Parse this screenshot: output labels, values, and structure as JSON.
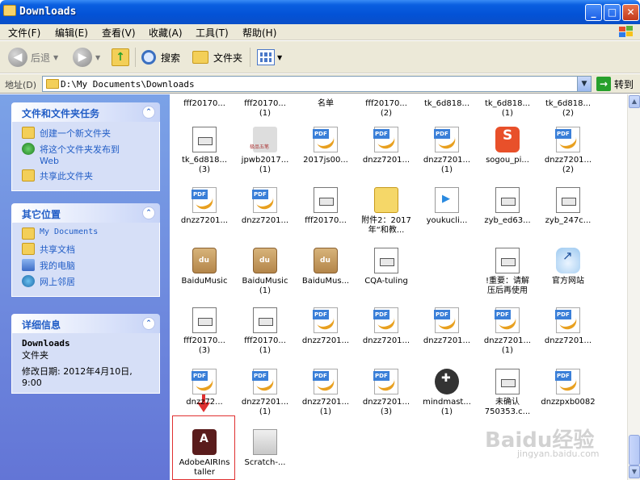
{
  "window": {
    "title": "Downloads",
    "min": "_",
    "max": "□",
    "close": "✕"
  },
  "menu": [
    "文件(F)",
    "编辑(E)",
    "查看(V)",
    "收藏(A)",
    "工具(T)",
    "帮助(H)"
  ],
  "toolbar": {
    "back": "后退",
    "search": "搜索",
    "folders": "文件夹"
  },
  "address": {
    "label": "地址(D)",
    "path": "D:\\My Documents\\Downloads",
    "go": "转到"
  },
  "sidebar": {
    "tasks": {
      "title": "文件和文件夹任务",
      "items": [
        "创建一个新文件夹",
        "将这个文件夹发布到\nWeb",
        "共享此文件夹"
      ]
    },
    "places": {
      "title": "其它位置",
      "items": [
        "My Documents",
        "共享文档",
        "我的电脑",
        "网上邻居"
      ]
    },
    "details": {
      "title": "详细信息",
      "name": "Downloads",
      "type": "文件夹",
      "modified": "修改日期: 2012年4月10日,\n9:00"
    }
  },
  "files": [
    {
      "label": "fff20170...",
      "icon": "doc-icon"
    },
    {
      "label": "fff20170...\n(1)",
      "icon": "doc-icon"
    },
    {
      "label": "名单",
      "icon": "doc-icon"
    },
    {
      "label": "fff20170...\n(2)",
      "icon": "doc-icon"
    },
    {
      "label": "tk_6d818...",
      "icon": "doc-icon"
    },
    {
      "label": "tk_6d818...\n(1)",
      "icon": "doc-icon"
    },
    {
      "label": "tk_6d818...\n(2)",
      "icon": "doc-icon"
    },
    {
      "label": "tk_6d818...\n(3)",
      "icon": "doc-icon"
    },
    {
      "label": "jpwb2017...\n(1)",
      "icon": "jpwb-icon"
    },
    {
      "label": "2017js00...",
      "icon": "pdf-icon"
    },
    {
      "label": "dnzz7201...",
      "icon": "pdf-icon"
    },
    {
      "label": "dnzz7201...\n(1)",
      "icon": "pdf-icon"
    },
    {
      "label": "sogou_pi...",
      "icon": "sogou-icon"
    },
    {
      "label": "dnzz7201...\n(2)",
      "icon": "pdf-icon"
    },
    {
      "label": "dnzz7201...",
      "icon": "pdf-icon"
    },
    {
      "label": "dnzz7201...",
      "icon": "pdf-icon"
    },
    {
      "label": "fff20170...",
      "icon": "doc-icon"
    },
    {
      "label": "附件2：2017\n年“和教...",
      "icon": "folder-icon"
    },
    {
      "label": "youkucli...",
      "icon": "video-icon"
    },
    {
      "label": "zyb_ed63...",
      "icon": "doc-icon"
    },
    {
      "label": "zyb_247c...",
      "icon": "doc-icon"
    },
    {
      "label": "BaiduMusic",
      "icon": "box-icon"
    },
    {
      "label": "BaiduMusic\n(1)",
      "icon": "box-icon"
    },
    {
      "label": "BaiduMus...",
      "icon": "box-icon"
    },
    {
      "label": "CQA-tuling",
      "icon": "doc-icon"
    },
    {
      "label": "",
      "icon": "none"
    },
    {
      "label": "!重要：请解\n压后再使用",
      "icon": "doc-icon"
    },
    {
      "label": "官方网站",
      "icon": "cloud-icon"
    },
    {
      "label": "fff20170...\n(3)",
      "icon": "doc-icon"
    },
    {
      "label": "fff20170...\n(1)",
      "icon": "doc-icon"
    },
    {
      "label": "dnzz7201...",
      "icon": "pdf-icon"
    },
    {
      "label": "dnzz7201...",
      "icon": "pdf-icon"
    },
    {
      "label": "dnzz7201...",
      "icon": "pdf-icon"
    },
    {
      "label": "dnzz7201...\n(1)",
      "icon": "pdf-icon"
    },
    {
      "label": "dnzz7201...",
      "icon": "pdf-icon"
    },
    {
      "label": "dnzz72...",
      "icon": "pdf-icon"
    },
    {
      "label": "dnzz7201...\n(1)",
      "icon": "pdf-icon"
    },
    {
      "label": "dnzz7201...\n(1)",
      "icon": "pdf-icon"
    },
    {
      "label": "dnzz7201...\n(3)",
      "icon": "pdf-icon"
    },
    {
      "label": "mindmast...\n(1)",
      "icon": "mind-icon"
    },
    {
      "label": "未确认\n750353.c...",
      "icon": "doc-icon"
    },
    {
      "label": "dnzzpxb0082",
      "icon": "pdf-icon"
    },
    {
      "label": "AdobeAIRIns\ntaller",
      "icon": "air-icon"
    },
    {
      "label": "Scratch-...",
      "icon": "scratch-icon"
    }
  ],
  "watermark": {
    "brand": "Baidu经验",
    "url": "jingyan.baidu.com"
  }
}
